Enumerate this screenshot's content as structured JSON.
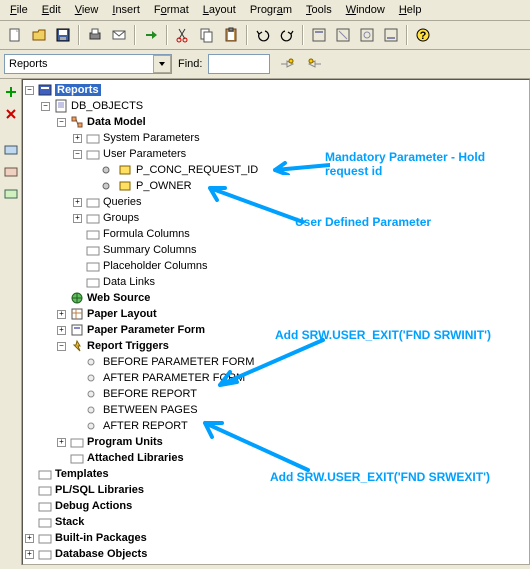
{
  "menu": {
    "file": "File",
    "edit": "Edit",
    "view": "View",
    "insert": "Insert",
    "format": "Format",
    "layout": "Layout",
    "program": "Program",
    "tools": "Tools",
    "window": "Window",
    "help": "Help"
  },
  "combo": {
    "value": "Reports",
    "find_label": "Find:",
    "find_value": ""
  },
  "tree": {
    "root": "Reports",
    "db": "DB_OBJECTS",
    "datamodel": "Data Model",
    "sysparams": "System Parameters",
    "userparams": "User Parameters",
    "p_conc": "P_CONC_REQUEST_ID",
    "p_owner": "P_OWNER",
    "queries": "Queries",
    "groups": "Groups",
    "formcols": "Formula Columns",
    "sumcols": "Summary Columns",
    "phcols": "Placeholder Columns",
    "datalinks": "Data Links",
    "websrc": "Web Source",
    "paperlayout": "Paper Layout",
    "paperparam": "Paper Parameter Form",
    "reptrig": "Report Triggers",
    "t1": "BEFORE PARAMETER FORM",
    "t2": "AFTER PARAMETER FORM",
    "t3": "BEFORE REPORT",
    "t4": "BETWEEN PAGES",
    "t5": "AFTER REPORT",
    "progunits": "Program Units",
    "attlibs": "Attached Libraries",
    "templates": "Templates",
    "plsql": "PL/SQL Libraries",
    "debug": "Debug Actions",
    "stack": "Stack",
    "builtin": "Built-in Packages",
    "dbobj": "Database Objects"
  },
  "anno": {
    "mand": "Mandatory Parameter - Hold request id",
    "udp": "User Defined Parameter",
    "srwinit": "Add SRW.USER_EXIT('FND SRWINIT')",
    "srwexit": "Add  SRW.USER_EXIT('FND SRWEXIT')"
  }
}
